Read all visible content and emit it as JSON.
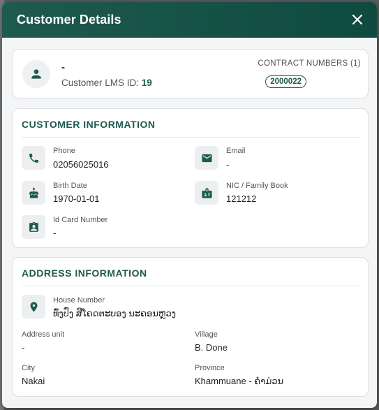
{
  "header": {
    "title": "Customer Details"
  },
  "summary": {
    "name": "-",
    "lms_label": "Customer LMS ID: ",
    "lms_id": "19",
    "contracts_title": "CONTRACT NUMBERS (1)",
    "contracts": [
      "2000022"
    ]
  },
  "customer_info": {
    "title": "CUSTOMER INFORMATION",
    "phone": {
      "label": "Phone",
      "value": "02056025016",
      "icon": "phone-icon"
    },
    "email": {
      "label": "Email",
      "value": "-",
      "icon": "email-icon"
    },
    "birth_date": {
      "label": "Birth Date",
      "value": "1970-01-01",
      "icon": "cake-icon"
    },
    "nic": {
      "label": "NIC / Family Book",
      "value": "121212",
      "icon": "id-badge-icon"
    },
    "id_card": {
      "label": "Id Card Number",
      "value": "-",
      "icon": "contact-card-icon"
    }
  },
  "address_info": {
    "title": "ADDRESS INFORMATION",
    "house_number": {
      "label": "House Number",
      "value": "ທົ່ງປົ່ງ ສີໂຄດຕະບອງ ນະຄອນຫຼວງ",
      "icon": "location-pin-icon"
    },
    "address_unit": {
      "label": "Address unit",
      "value": "-"
    },
    "village": {
      "label": "Village",
      "value": "B. Done"
    },
    "city": {
      "label": "City",
      "value": "Nakai"
    },
    "province": {
      "label": "Province",
      "value": "Khammuane - ຄຳມ່ວນ"
    }
  },
  "colors": {
    "accent": "#1d5a4f",
    "header_bg": "#1a5448"
  }
}
